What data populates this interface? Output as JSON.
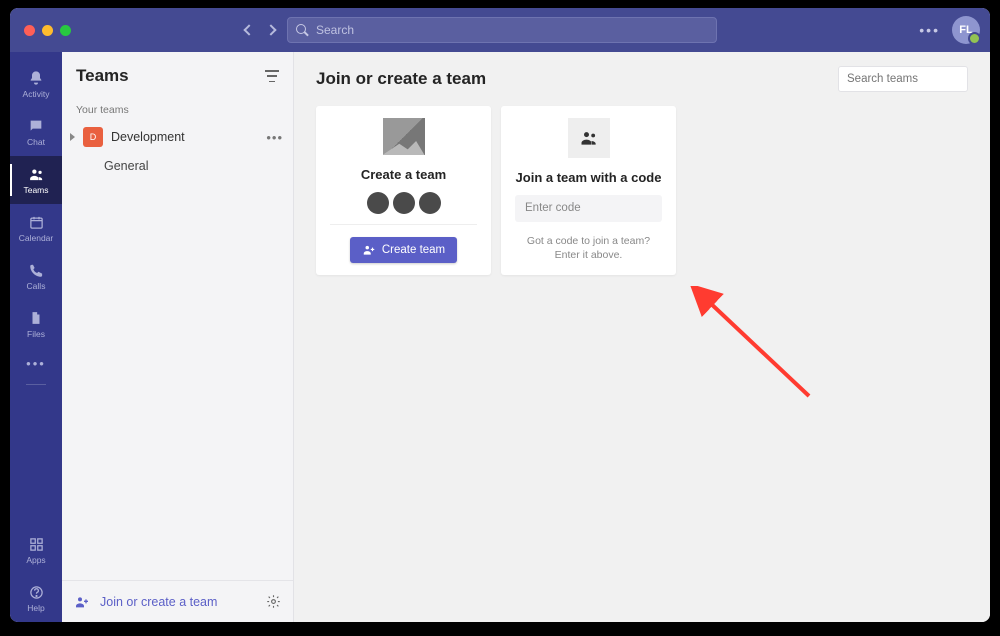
{
  "titlebar": {
    "search_placeholder": "Search",
    "avatar_initials": "FL"
  },
  "rail": {
    "items": [
      {
        "id": "activity",
        "label": "Activity"
      },
      {
        "id": "chat",
        "label": "Chat"
      },
      {
        "id": "teams",
        "label": "Teams"
      },
      {
        "id": "calendar",
        "label": "Calendar"
      },
      {
        "id": "calls",
        "label": "Calls"
      },
      {
        "id": "files",
        "label": "Files"
      }
    ],
    "apps_label": "Apps",
    "help_label": "Help"
  },
  "panel": {
    "title": "Teams",
    "section_label": "Your teams",
    "team": {
      "initials": "D",
      "name": "Development"
    },
    "channel": "General",
    "footer_link": "Join or create a team"
  },
  "main": {
    "title": "Join or create a team",
    "search_placeholder": "Search teams",
    "create_card": {
      "title": "Create a team",
      "button": "Create team"
    },
    "join_card": {
      "title": "Join a team with a code",
      "placeholder": "Enter code",
      "help_text": "Got a code to join a team? Enter it above."
    }
  }
}
